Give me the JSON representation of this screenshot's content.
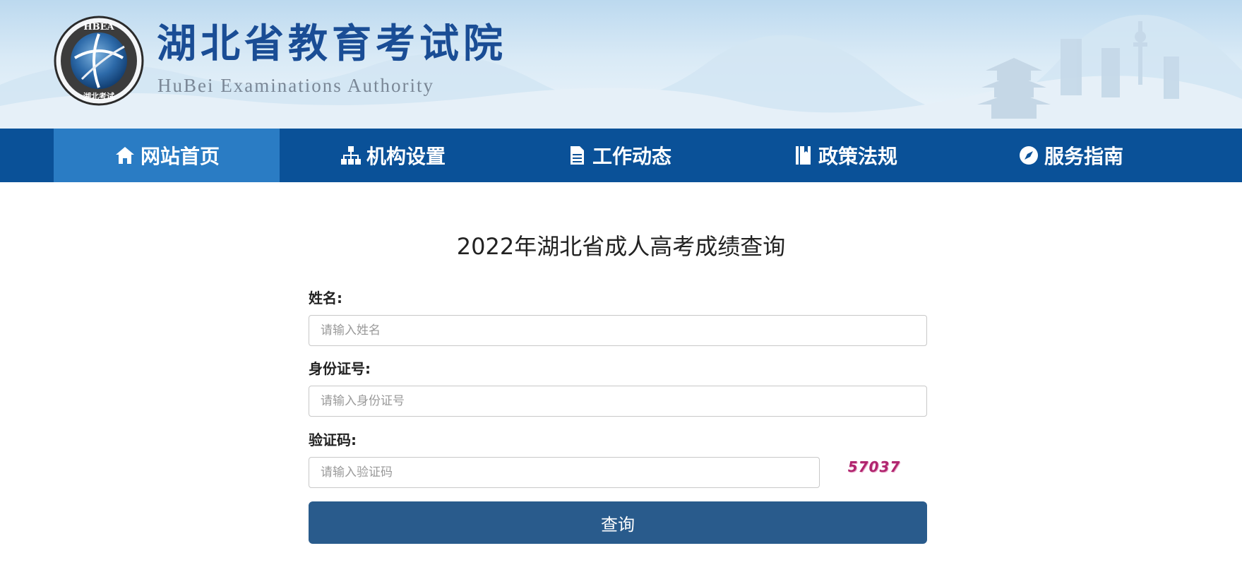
{
  "header": {
    "title": "湖北省教育考试院",
    "subtitle": "HuBei Examinations Authority",
    "logo": {
      "ring_text": "HBEA",
      "seal_text": "湖北考试",
      "icon": "globe-seal-icon"
    }
  },
  "nav": {
    "items": [
      {
        "label": "网站首页",
        "icon": "home-icon",
        "active": true
      },
      {
        "label": "机构设置",
        "icon": "org-chart-icon",
        "active": false
      },
      {
        "label": "工作动态",
        "icon": "document-icon",
        "active": false
      },
      {
        "label": "政策法规",
        "icon": "book-icon",
        "active": false
      },
      {
        "label": "服务指南",
        "icon": "compass-icon",
        "active": false
      }
    ]
  },
  "form": {
    "title": "2022年湖北省成人高考成绩查询",
    "name": {
      "label": "姓名:",
      "placeholder": "请输入姓名",
      "value": ""
    },
    "id_number": {
      "label": "身份证号:",
      "placeholder": "请输入身份证号",
      "value": ""
    },
    "captcha": {
      "label": "验证码:",
      "placeholder": "请输入验证码",
      "value": "",
      "image_text": "57037"
    },
    "submit_label": "查询"
  },
  "colors": {
    "nav_bg": "#0a5198",
    "nav_active": "#2a7cc4",
    "button_bg": "#295b8c",
    "title_blue": "#1a4d95",
    "captcha_text": "#b0246e"
  }
}
